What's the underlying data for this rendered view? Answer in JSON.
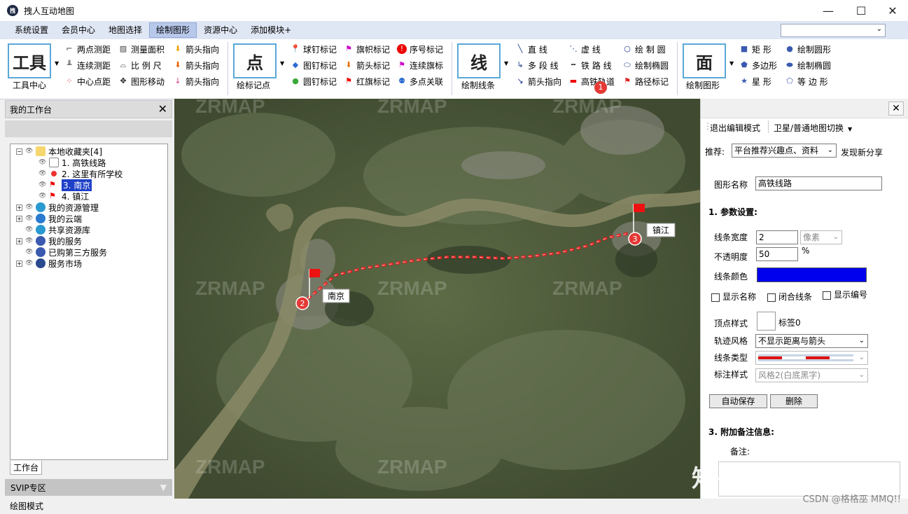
{
  "window": {
    "title": "拽人互动地图",
    "minimize": "—",
    "maximize": "☐",
    "close": "✕"
  },
  "menu": [
    "系统设置",
    "会员中心",
    "地图选择",
    "绘制图形",
    "资源中心",
    "添加模块+"
  ],
  "ribbon": {
    "tools": {
      "big": "工具",
      "caption": "工具中心",
      "items": [
        "两点测距",
        "连续测距",
        "中心点距",
        "测量面积",
        "比 例 尺",
        "图形移动",
        "箭头指向",
        "箭头指向",
        "箭头指向"
      ]
    },
    "point": {
      "big": "点",
      "caption": "绘标记点",
      "items": [
        "球钉标记",
        "图钉标记",
        "圆钉标记",
        "旗帜标记",
        "箭头标记",
        "红旗标记",
        "序号标记",
        "连续旗标",
        "多点关联"
      ]
    },
    "line": {
      "big": "线",
      "caption": "绘制线条",
      "items": [
        "直 线",
        "多 段 线",
        "箭头指向",
        "虚 线",
        "铁 路 线",
        "高铁轨道",
        "绘 制 圆",
        "绘制椭圆",
        "路径标记"
      ]
    },
    "area": {
      "big": "面",
      "caption": "绘制图形",
      "items": [
        "矩 形",
        "多边形",
        "星 形",
        "绘制圆形",
        "绘制椭圆",
        "等 边 形"
      ]
    },
    "badge": "1"
  },
  "left_panel": {
    "title": "我的工作台",
    "close": "✕",
    "tree": {
      "root": "本地收藏夹[4]",
      "children": [
        "1. 高铁线路",
        "2. 这里有所学校",
        "3. 南京",
        "4. 镇江"
      ],
      "others": [
        "我的资源管理",
        "我的云端",
        "共享资源库",
        "我的服务",
        "已购第三方服务",
        "服务市场"
      ]
    },
    "tab": "工作台",
    "svip": "SVIP专区"
  },
  "status": "绘图模式",
  "map": {
    "labels": [
      "南京",
      "镇江"
    ],
    "markers": [
      "2",
      "3"
    ],
    "watermarks": [
      "ZRMAP",
      "ZRMAP",
      "ZRMAP",
      "ZRMAP",
      "ZRMAP",
      "ZRMAP",
      "ZRMAP",
      "ZRMAP"
    ]
  },
  "right_panel": {
    "close": "✕",
    "toolbar": [
      "退出编辑模式",
      "卫星/普通地图切换"
    ],
    "recommend_label": "推荐:",
    "recommend_value": "平台推荐兴趣点、资料",
    "recommend_link": "发现新分享",
    "shape_name_label": "图形名称",
    "shape_name_value": "高铁线路",
    "section1": "1. 参数设置:",
    "line_width_label": "线条宽度",
    "line_width_value": "2",
    "unit_value": "像素",
    "opacity_label": "不透明度",
    "opacity_value": "50",
    "percent": "%",
    "line_color_label": "线条颜色",
    "line_color": "#0000ee",
    "check_show_name": "显示名称",
    "check_close_line": "闭合线条",
    "check_show_number": "显示编号",
    "vertex_style_label": "顶点样式",
    "vertex_style_value": "标签0",
    "track_style_label": "轨迹风格",
    "track_style_value": "不显示距离与箭头",
    "line_type_label": "线条类型",
    "annotation_style_label": "标注样式",
    "annotation_style_value": "风格2(白底黑字)",
    "btn_autosave": "自动保存",
    "btn_delete": "删除",
    "section3": "3. 附加备注信息:",
    "remark_label": "备注:"
  },
  "overlay": {
    "zhihu": "知乎 @城市盒子",
    "csdn": "CSDN @格格巫 MMQ!!"
  }
}
